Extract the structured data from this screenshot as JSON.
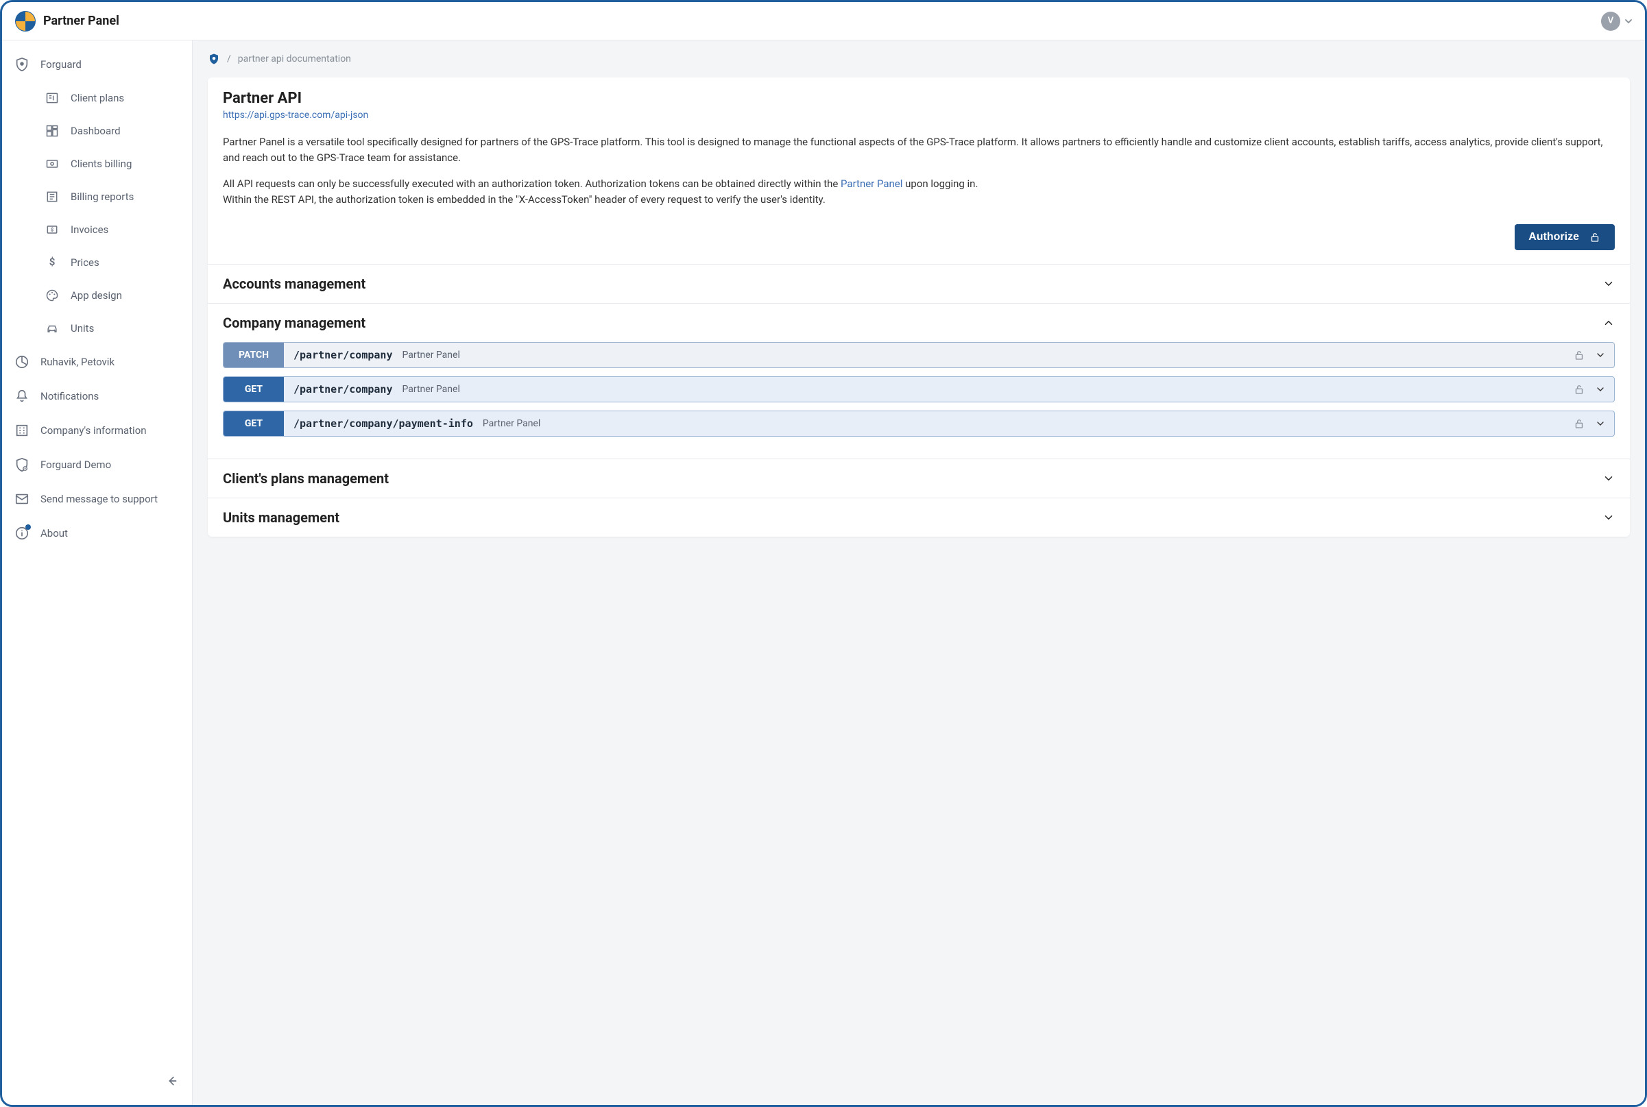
{
  "brand": {
    "title": "Partner Panel",
    "avatarInitial": "V"
  },
  "sidebar": {
    "tenant": "Forguard",
    "items": [
      {
        "label": "Client plans"
      },
      {
        "label": "Dashboard"
      },
      {
        "label": "Clients billing"
      },
      {
        "label": "Billing reports"
      },
      {
        "label": "Invoices"
      },
      {
        "label": "Prices"
      },
      {
        "label": "App design"
      },
      {
        "label": "Units"
      }
    ],
    "bottom": [
      {
        "label": "Ruhavik, Petovik"
      },
      {
        "label": "Notifications"
      },
      {
        "label": "Company's information"
      },
      {
        "label": "Forguard Demo"
      },
      {
        "label": "Send message to support"
      },
      {
        "label": "About"
      }
    ]
  },
  "crumbs": {
    "current": "partner api documentation"
  },
  "api": {
    "title": "Partner API",
    "link": "https://api.gps-trace.com/api-json",
    "descP1": "Partner Panel is a versatile tool specifically designed for partners of the GPS-Trace platform. This tool is designed to manage the functional aspects of the GPS-Trace platform. It allows partners to efficiently handle and customize client accounts, establish tariffs, access analytics, provide client's support, and reach out to the GPS-Trace team for assistance.",
    "descP2a": "All API requests can only be successfully executed with an authorization token. Authorization tokens can be obtained directly within the ",
    "descP2Link": "Partner Panel",
    "descP2b": " upon logging in.",
    "descP3": "Within the REST API, the authorization token is embedded in the \"X-AccessToken\" header of every request to verify the user's identity.",
    "authorizeLabel": "Authorize"
  },
  "sections": [
    {
      "title": "Accounts management",
      "expanded": false
    },
    {
      "title": "Company management",
      "expanded": true,
      "ops": [
        {
          "method": "PATCH",
          "class": "patch",
          "path": "/partner/company",
          "summary": "Partner Panel"
        },
        {
          "method": "GET",
          "class": "get",
          "path": "/partner/company",
          "summary": "Partner Panel"
        },
        {
          "method": "GET",
          "class": "get",
          "path": "/partner/company/payment-info",
          "summary": "Partner Panel"
        }
      ]
    },
    {
      "title": "Client's plans management",
      "expanded": false
    },
    {
      "title": "Units management",
      "expanded": false
    }
  ]
}
